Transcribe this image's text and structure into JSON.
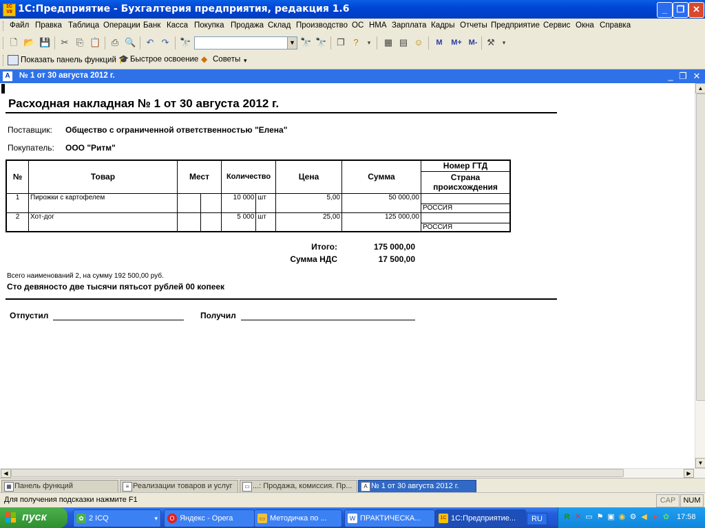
{
  "window": {
    "title": "1С:Предприятие - Бухгалтерия предприятия, редакция 1.6",
    "icon": "1C V8"
  },
  "menu": [
    "Файл",
    "Правка",
    "Таблица",
    "Операции",
    "Банк",
    "Касса",
    "Покупка",
    "Продажа",
    "Склад",
    "Производство",
    "ОС",
    "НМА",
    "Зарплата",
    "Кадры",
    "Отчеты",
    "Предприятие",
    "Сервис",
    "Окна",
    "Справка"
  ],
  "toolbar2": {
    "show_panel": "Показать панель функций",
    "quick_learn": "Быстрое освоение",
    "tips": "Советы"
  },
  "toolbar1": {
    "m": "M",
    "mplus": "M+",
    "mminus": "M-"
  },
  "docwindow": {
    "title": "№ 1 от 30 августа 2012 г."
  },
  "doc": {
    "title": "Расходная накладная № 1 от 30 августа 2012 г.",
    "supplier_label": "Поставщик:",
    "supplier": "Общество с ограниченной ответственностью \"Елена\"",
    "buyer_label": "Покупатель:",
    "buyer": "ООО \"Ритм\"",
    "headers": {
      "num": "№",
      "item": "Товар",
      "places": "Мест",
      "qty": "Количество",
      "price": "Цена",
      "sum": "Сумма",
      "gtd": "Номер ГТД",
      "country": "Страна происхождения"
    },
    "rows": [
      {
        "num": "1",
        "item": "Пирожки с картофелем",
        "qty": "10 000",
        "unit": "шт",
        "price": "5,00",
        "sum": "50 000,00",
        "country": "РОССИЯ"
      },
      {
        "num": "2",
        "item": "Хот-дог",
        "qty": "5 000",
        "unit": "шт",
        "price": "25,00",
        "sum": "125 000,00",
        "country": "РОССИЯ"
      }
    ],
    "total_label": "Итого:",
    "total": "175 000,00",
    "vat_label": "Сумма НДС",
    "vat": "17 500,00",
    "summary": "Всего наименований 2, на сумму 192 500,00 руб.",
    "summary_words": "Сто девяносто две тысячи пятьсот рублей 00 копеек",
    "released": "Отпустил",
    "received": "Получил"
  },
  "tasktabs": [
    {
      "label": "Панель функций",
      "active": false
    },
    {
      "label": "Реализации товаров и услуг",
      "active": false
    },
    {
      "label": "...: Продажа, комиссия. Пр...",
      "active": false
    },
    {
      "label": "№ 1 от 30 августа 2012 г.",
      "active": true
    }
  ],
  "status": {
    "hint": "Для получения подсказки нажмите F1",
    "cap": "CAP",
    "num": "NUM"
  },
  "taskbar": {
    "start": "пуск",
    "items": [
      {
        "label": "2 ICQ",
        "icon": "icq-icon"
      },
      {
        "label": "Яндекс - Opera",
        "icon": "opera-icon"
      },
      {
        "label": "Методичка по ...",
        "icon": "folder-icon"
      },
      {
        "label": "ПРАКТИЧЕСКА...",
        "icon": "word-icon"
      },
      {
        "label": "1С:Предприятие...",
        "icon": "1c-icon"
      }
    ],
    "lang": "RU",
    "time": "17:58"
  },
  "colors": {
    "title_bar": "#0046d5",
    "taskbar": "#245edb",
    "start": "#2f8f2f",
    "active_tab": "#3169c6"
  }
}
